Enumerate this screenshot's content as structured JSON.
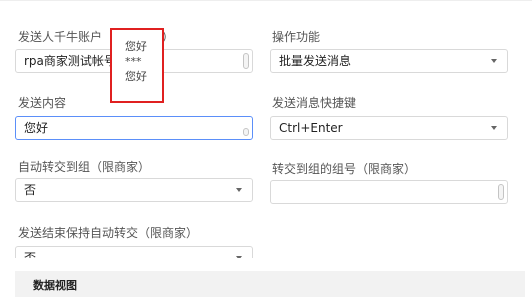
{
  "form": {
    "sender_account": {
      "label_prefix": "发送人千牛账户（",
      "label_suffix": "户）",
      "value": "rpa商家测试帐号"
    },
    "function": {
      "label": "操作功能",
      "value": "批量发送消息"
    },
    "content": {
      "label": "发送内容",
      "value": "您好"
    },
    "shortcut": {
      "label": "发送消息快捷键",
      "value": "Ctrl+Enter"
    },
    "auto_transfer": {
      "label": "自动转交到组（限商家）",
      "value": "否"
    },
    "transfer_group": {
      "label": "转交到组的组号（限商家）",
      "value": ""
    },
    "keep_auto_transfer": {
      "label": "发送结束保持自动转交（限商家）",
      "value": "否"
    }
  },
  "popup": {
    "items": [
      "您好",
      "***",
      "您好"
    ]
  },
  "section": {
    "title": "数据视图"
  }
}
